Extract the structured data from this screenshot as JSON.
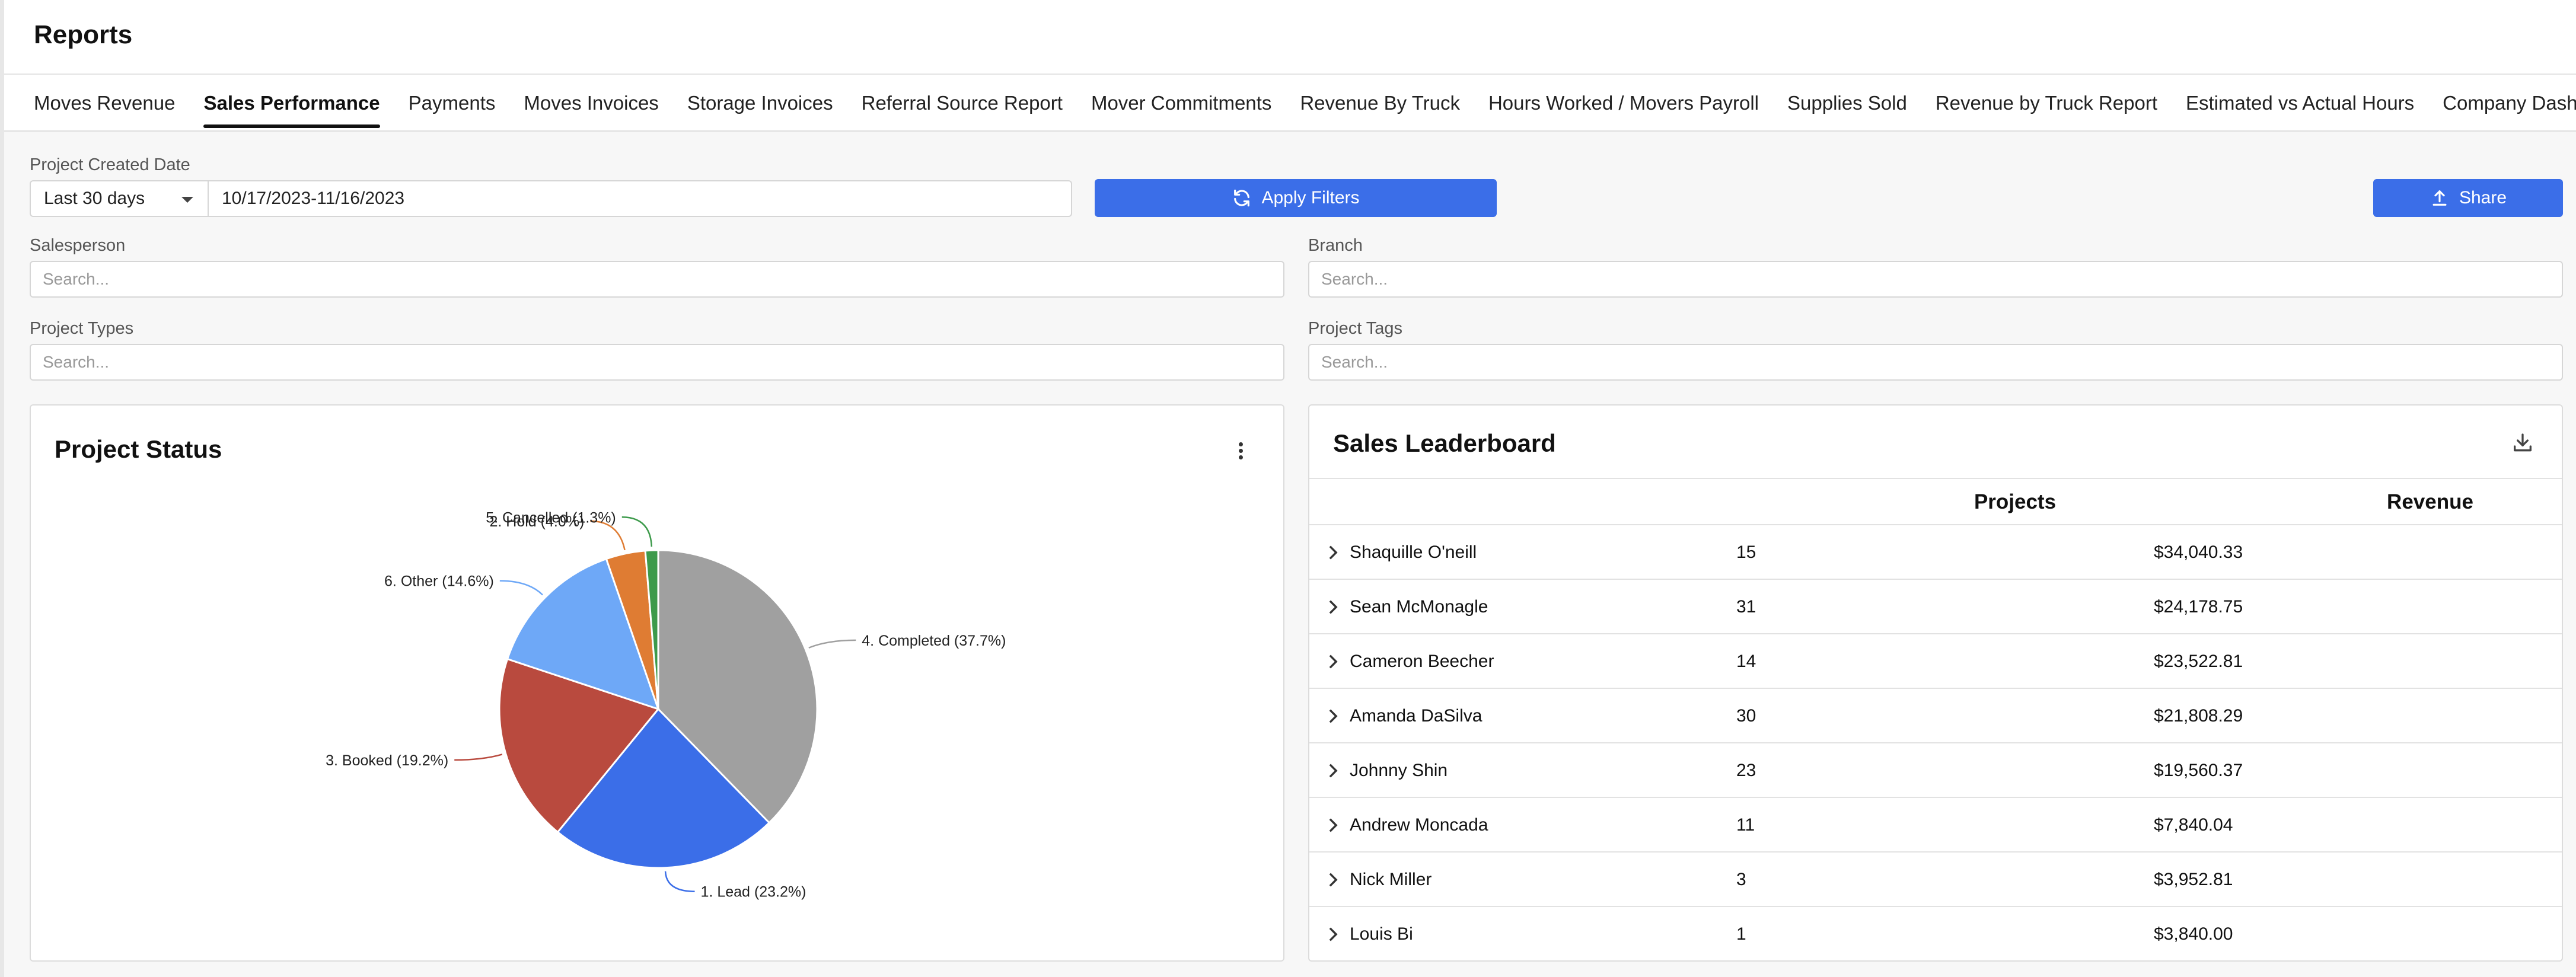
{
  "header": {
    "title": "Reports"
  },
  "tabs": [
    {
      "label": "Moves Revenue",
      "active": false
    },
    {
      "label": "Sales Performance",
      "active": true
    },
    {
      "label": "Payments",
      "active": false
    },
    {
      "label": "Moves Invoices",
      "active": false
    },
    {
      "label": "Storage Invoices",
      "active": false
    },
    {
      "label": "Referral Source Report",
      "active": false
    },
    {
      "label": "Mover Commitments",
      "active": false
    },
    {
      "label": "Revenue By Truck",
      "active": false
    },
    {
      "label": "Hours Worked / Movers Payroll",
      "active": false
    },
    {
      "label": "Supplies Sold",
      "active": false
    },
    {
      "label": "Revenue by Truck Report",
      "active": false
    },
    {
      "label": "Estimated vs Actual Hours",
      "active": false
    },
    {
      "label": "Company Dashboard",
      "active": false
    }
  ],
  "filters": {
    "project_created_date": {
      "label": "Project Created Date",
      "range": "Last 30 days",
      "dates": "10/17/2023-11/16/2023"
    },
    "salesperson": {
      "label": "Salesperson",
      "placeholder": "Search..."
    },
    "branch": {
      "label": "Branch",
      "placeholder": "Search..."
    },
    "project_types": {
      "label": "Project Types",
      "placeholder": "Search..."
    },
    "project_tags": {
      "label": "Project Tags",
      "placeholder": "Search..."
    },
    "apply_label": "Apply Filters",
    "share_label": "Share"
  },
  "project_status": {
    "title": "Project Status",
    "chart_data": {
      "type": "pie",
      "slices": [
        {
          "label": "4. Completed (37.7%)",
          "value": 37.7,
          "color": "#a0a0a0"
        },
        {
          "label": "1. Lead (23.2%)",
          "value": 23.2,
          "color": "#3b6ee8"
        },
        {
          "label": "3. Booked (19.2%)",
          "value": 19.2,
          "color": "#b94a3e"
        },
        {
          "label": "6. Other (14.6%)",
          "value": 14.6,
          "color": "#6ea8f7"
        },
        {
          "label": "2. Hold (4.0%)",
          "value": 4.0,
          "color": "#df7c33"
        },
        {
          "label": "5. Cancelled (1.3%)",
          "value": 1.3,
          "color": "#3d9a4b"
        }
      ]
    }
  },
  "leaderboard": {
    "title": "Sales Leaderboard",
    "columns": [
      "Projects",
      "Revenue"
    ],
    "rows": [
      {
        "name": "Shaquille O'neill",
        "projects": "15",
        "revenue": "$34,040.33"
      },
      {
        "name": "Sean McMonagle",
        "projects": "31",
        "revenue": "$24,178.75"
      },
      {
        "name": "Cameron Beecher",
        "projects": "14",
        "revenue": "$23,522.81"
      },
      {
        "name": "Amanda DaSilva",
        "projects": "30",
        "revenue": "$21,808.29"
      },
      {
        "name": "Johnny Shin",
        "projects": "23",
        "revenue": "$19,560.37"
      },
      {
        "name": "Andrew Moncada",
        "projects": "11",
        "revenue": "$7,840.04"
      },
      {
        "name": "Nick Miller",
        "projects": "3",
        "revenue": "$3,952.81"
      },
      {
        "name": "Louis Bi",
        "projects": "1",
        "revenue": "$3,840.00"
      }
    ]
  }
}
